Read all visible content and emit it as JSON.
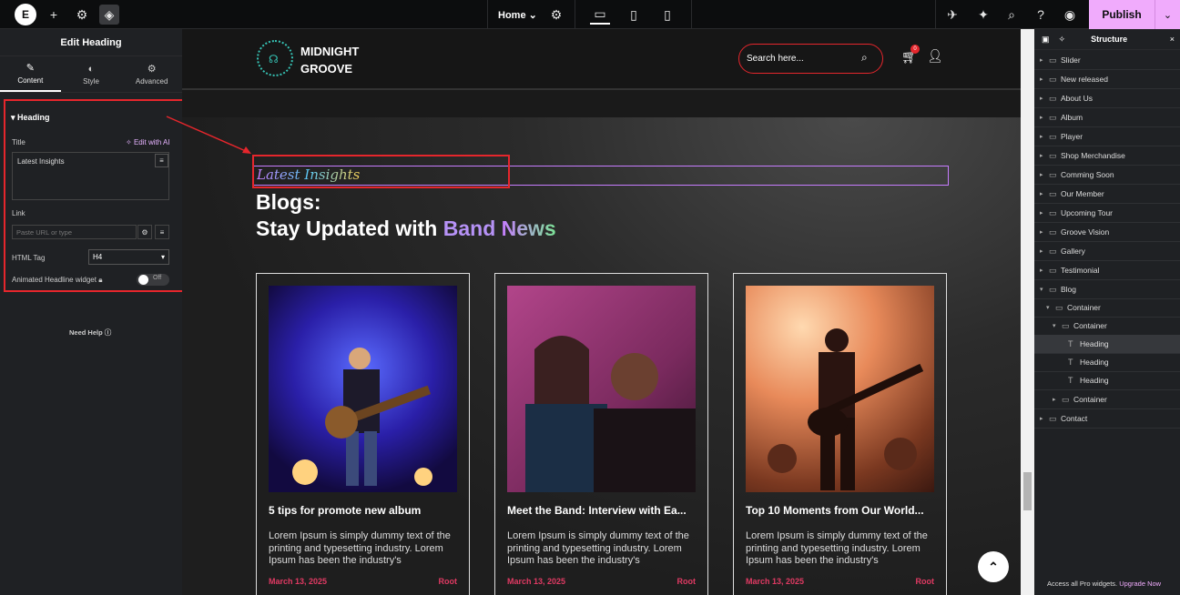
{
  "topbar": {
    "home": "Home",
    "publish": "Publish"
  },
  "panel": {
    "title": "Edit Heading",
    "tabs": [
      "Content",
      "Style",
      "Advanced"
    ],
    "section": "Heading",
    "title_label": "Title",
    "edit_ai": "Edit with AI",
    "title_value": "Latest Insights",
    "link_label": "Link",
    "link_placeholder": "Paste URL or type",
    "html_tag_label": "HTML Tag",
    "html_tag_value": "H4",
    "animated_label": "Animated Headline widget",
    "toggle": "Off",
    "help": "Need Help"
  },
  "site": {
    "brand_line1": "MIDNIGHT",
    "brand_line2": "GROOVE",
    "search_placeholder": "Search here...",
    "cart_count": "0",
    "eyebrow": "Latest Insights",
    "heading_line1": "Blogs:",
    "heading_line2_prefix": "Stay Updated with ",
    "heading_band": "Band",
    "heading_news": "News",
    "cards": [
      {
        "title": "5 tips for promote new album",
        "text": "Lorem Ipsum is simply dummy text of the printing and typesetting industry. Lorem Ipsum has been the industry's",
        "date": "March 13, 2025",
        "author": "Root"
      },
      {
        "title": "Meet the Band: Interview with Ea...",
        "text": "Lorem Ipsum is simply dummy text of the printing and typesetting industry. Lorem Ipsum has been the industry's",
        "date": "March 13, 2025",
        "author": "Root"
      },
      {
        "title": "Top 10 Moments from Our World...",
        "text": "Lorem Ipsum is simply dummy text of the printing and typesetting industry. Lorem Ipsum has been the industry's",
        "date": "March 13, 2025",
        "author": "Root"
      }
    ]
  },
  "navigator": {
    "title": "Structure",
    "items": [
      "Slider",
      "New released",
      "About Us",
      "Album",
      "Player",
      "Shop Merchandise",
      "Comming Soon",
      "Our Member",
      "Upcoming Tour",
      "Groove Vision",
      "Gallery",
      "Testimonial",
      "Blog",
      "Container",
      "Container",
      "Heading",
      "Heading",
      "Heading",
      "Container",
      "Contact"
    ],
    "footer_text": "Access all Pro widgets.",
    "footer_link": "Upgrade Now"
  },
  "colors": {
    "accent": "#f0abfc",
    "highlight": "#e5262c",
    "date": "#e03a63"
  }
}
